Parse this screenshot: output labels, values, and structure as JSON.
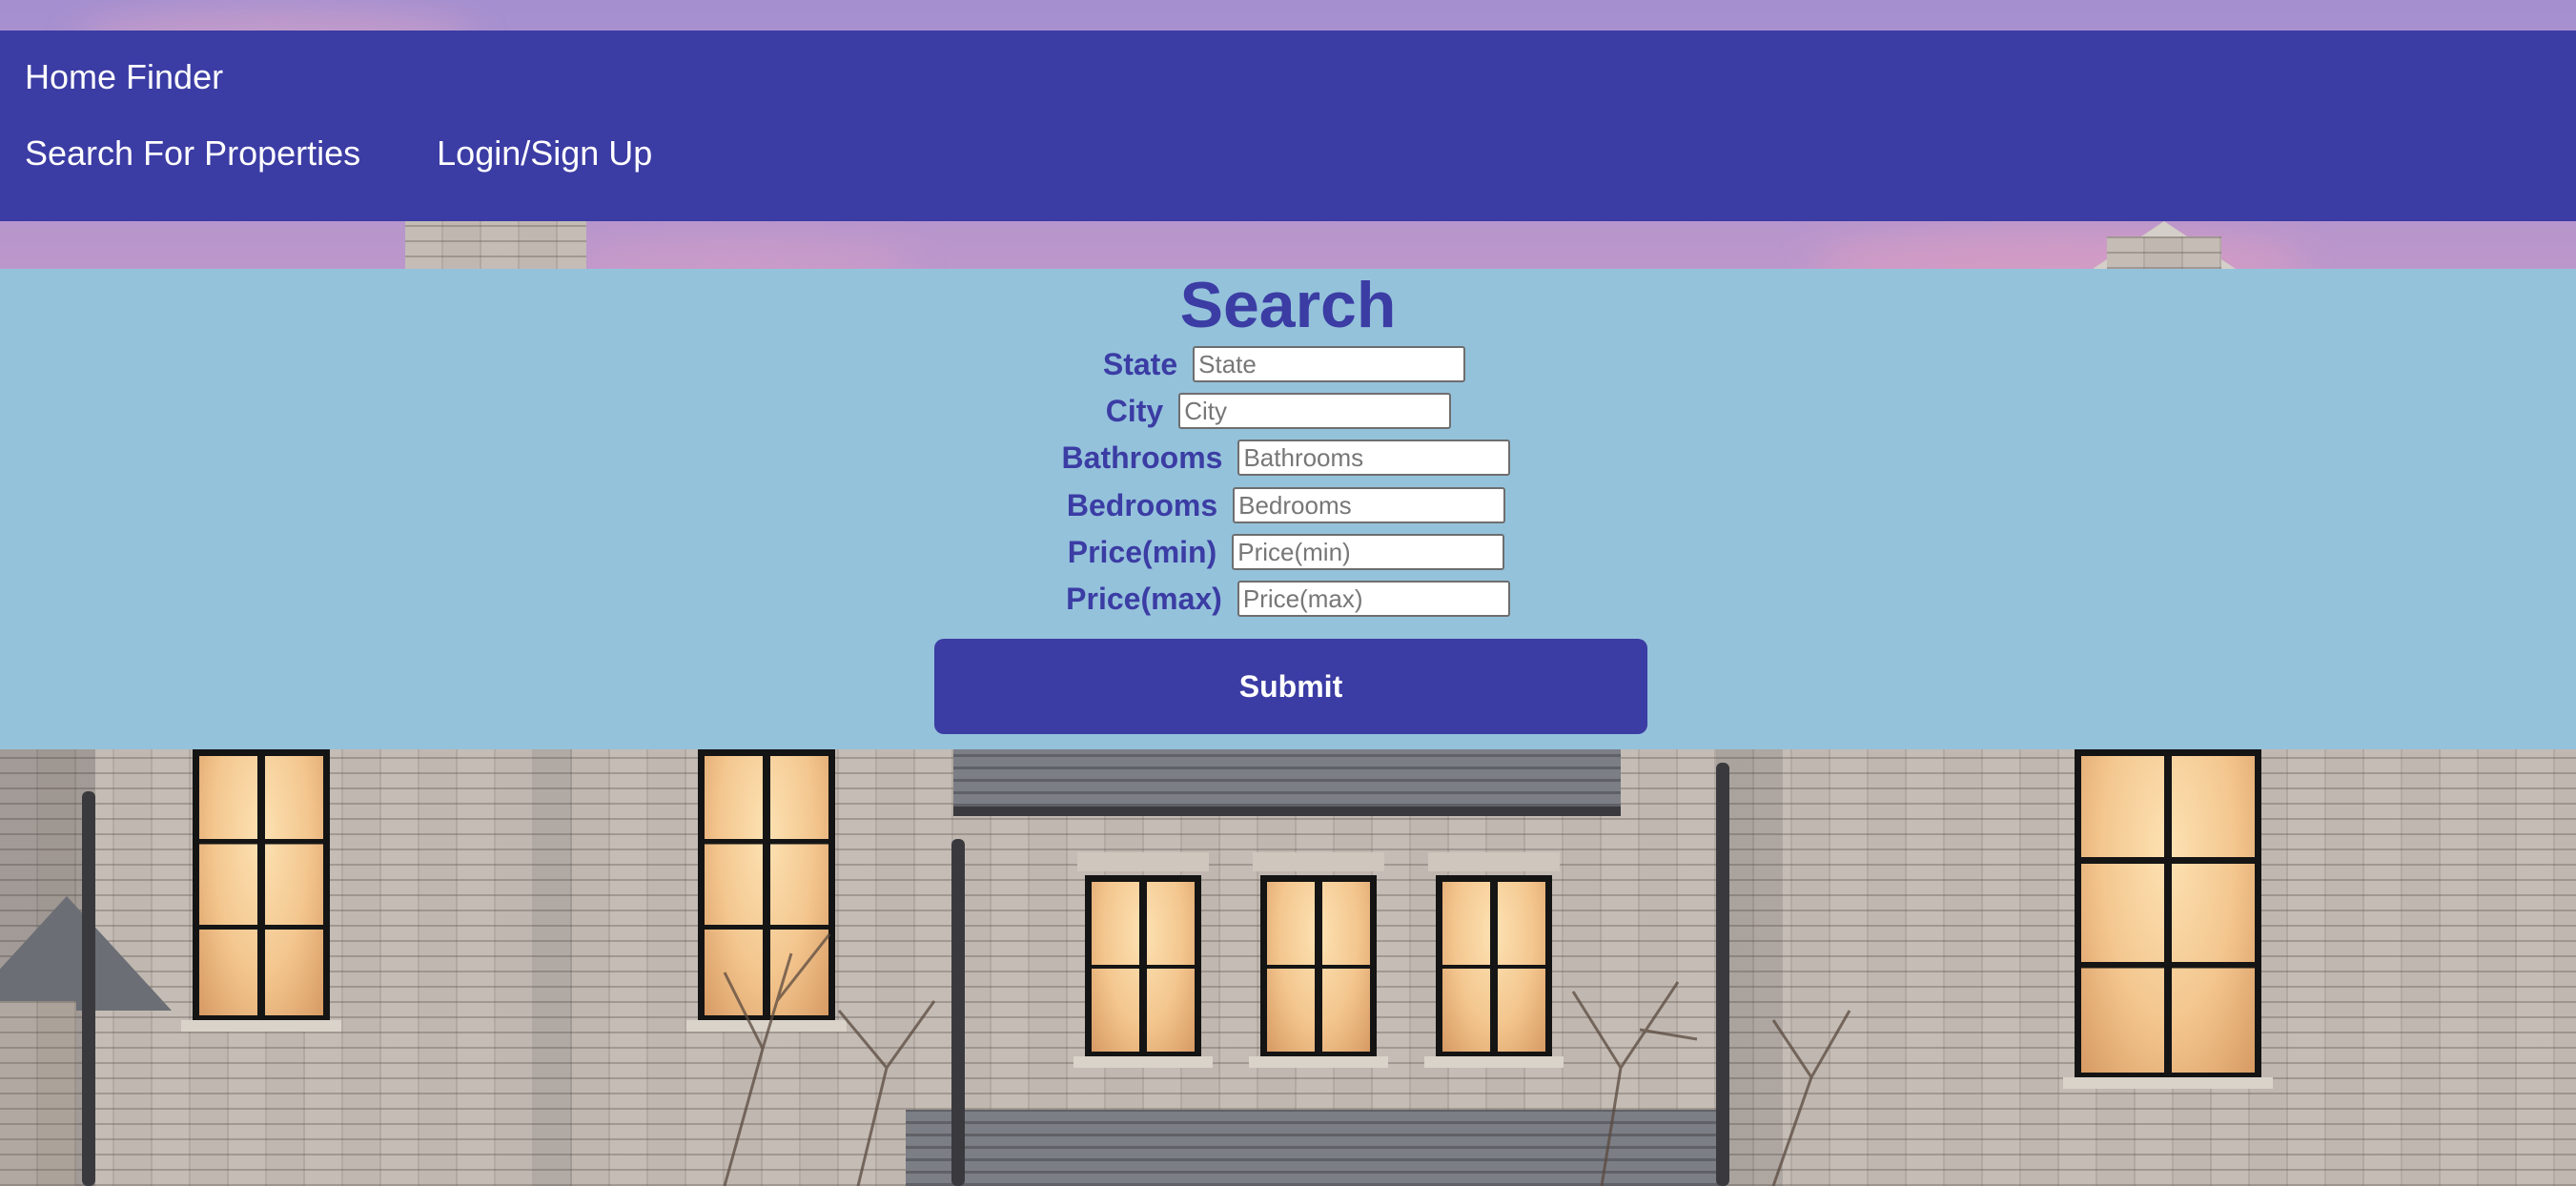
{
  "nav": {
    "brand": "Home Finder",
    "links": [
      {
        "label": "Search For Properties"
      },
      {
        "label": "Login/Sign Up"
      }
    ]
  },
  "search": {
    "title": "Search",
    "fields": [
      {
        "label": "State",
        "placeholder": "State",
        "value": ""
      },
      {
        "label": "City",
        "placeholder": "City",
        "value": ""
      },
      {
        "label": "Bathrooms",
        "placeholder": "Bathrooms",
        "value": ""
      },
      {
        "label": "Bedrooms",
        "placeholder": "Bedrooms",
        "value": ""
      },
      {
        "label": "Price(min)",
        "placeholder": "Price(min)",
        "value": ""
      },
      {
        "label": "Price(max)",
        "placeholder": "Price(max)",
        "value": ""
      }
    ],
    "submit_label": "Submit"
  },
  "colors": {
    "nav_background": "#3b3ca4",
    "panel_background": "#94c2db",
    "accent": "#3b3ca4",
    "button_text": "#ffffff"
  },
  "background": {
    "description_icon": "house-photo"
  }
}
